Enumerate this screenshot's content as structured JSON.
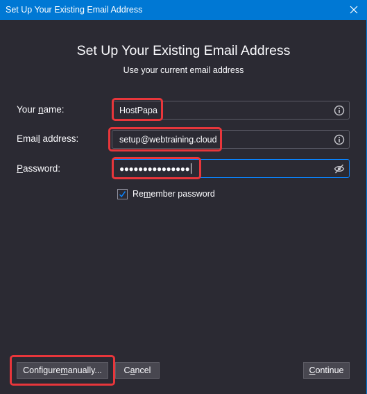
{
  "window": {
    "title": "Set Up Your Existing Email Address",
    "close_icon": "close-icon"
  },
  "header": {
    "title": "Set Up Your Existing Email Address",
    "subtitle": "Use your current email address"
  },
  "form": {
    "name": {
      "label_pre": "Your ",
      "label_access": "n",
      "label_post": "ame:",
      "value": "HostPapa",
      "icon": "info-icon"
    },
    "email": {
      "label_pre": "Emai",
      "label_access": "l",
      "label_post": " address:",
      "value": "setup@webtraining.cloud",
      "icon": "info-icon"
    },
    "password": {
      "label_pre": "",
      "label_access": "P",
      "label_post": "assword:",
      "value_masked": "●●●●●●●●●●●●●●●",
      "icon": "eye-slash-icon"
    },
    "remember": {
      "checked": true,
      "label_pre": "Re",
      "label_access": "m",
      "label_post": "ember password"
    }
  },
  "buttons": {
    "configure": {
      "pre": "Configure ",
      "access": "m",
      "post": "anually..."
    },
    "cancel": {
      "pre": "C",
      "access": "a",
      "post": "ncel"
    },
    "continue": {
      "pre": "",
      "access": "C",
      "post": "ontinue"
    }
  },
  "colors": {
    "titlebar": "#0078d4",
    "background": "#2b2a33",
    "highlight": "#e8363b",
    "focus": "#0a84ff"
  }
}
